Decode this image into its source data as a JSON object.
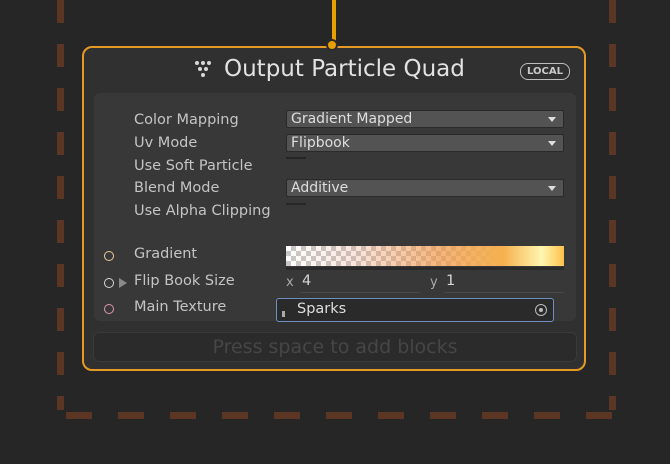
{
  "node": {
    "title": "Output Particle Quad",
    "badge": "LOCAL",
    "icon": "output-particle-icon",
    "accent_color": "#e59a25"
  },
  "properties": {
    "color_mapping": {
      "label": "Color Mapping",
      "value": "Gradient Mapped"
    },
    "uv_mode": {
      "label": "Uv Mode",
      "value": "Flipbook"
    },
    "use_soft_particle": {
      "label": "Use Soft Particle"
    },
    "blend_mode": {
      "label": "Blend Mode",
      "value": "Additive"
    },
    "use_alpha_clipping": {
      "label": "Use Alpha Clipping"
    }
  },
  "inputs": {
    "gradient": {
      "label": "Gradient"
    },
    "flip_book_size": {
      "label": "Flip Book Size",
      "x_label": "x",
      "x_value": "4",
      "y_label": "y",
      "y_value": "1"
    },
    "main_texture": {
      "label": "Main Texture",
      "value": "Sparks"
    }
  },
  "footer": {
    "add_blocks_hint": "Press space to add blocks"
  }
}
